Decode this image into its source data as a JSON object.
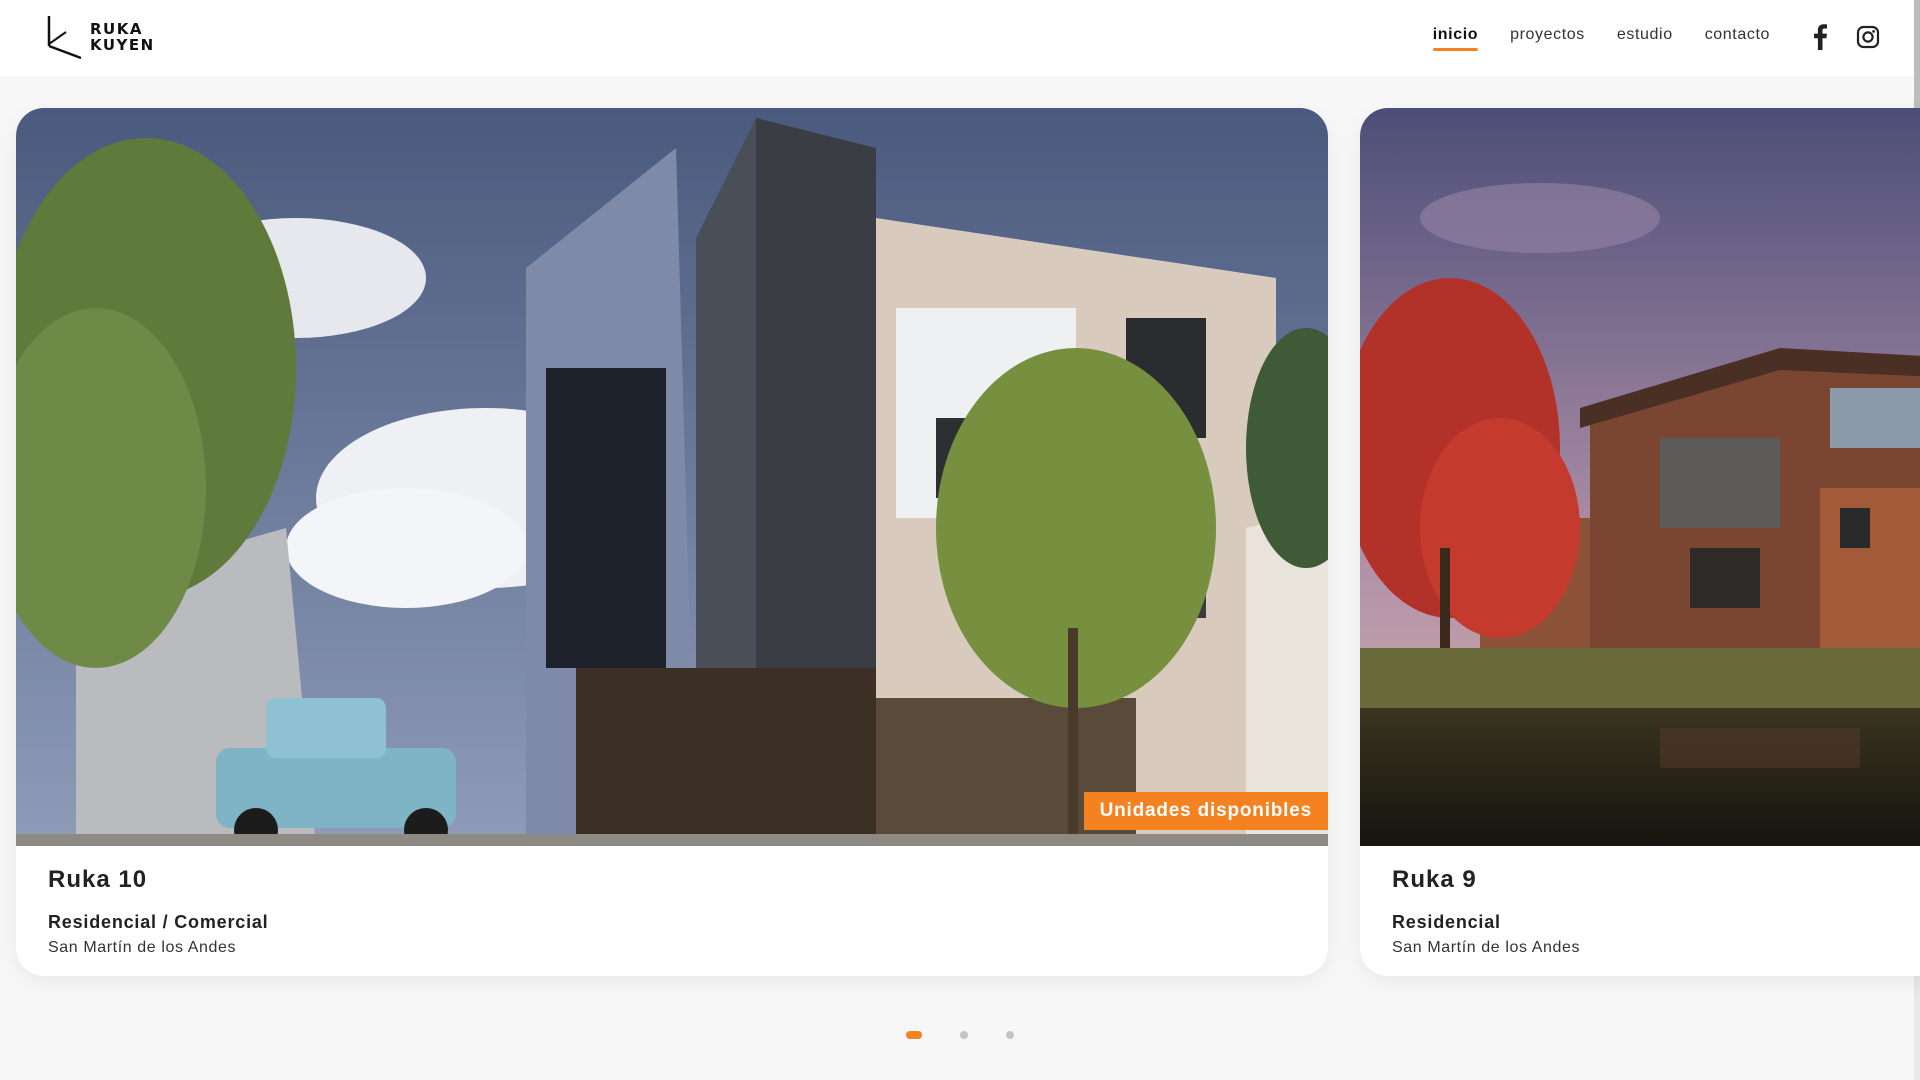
{
  "brand": {
    "line1": "RUKA",
    "line2": "KUYEN",
    "logo_icon": "k-logo-icon"
  },
  "nav": {
    "items": [
      {
        "label": "inicio",
        "active": true
      },
      {
        "label": "proyectos",
        "active": false
      },
      {
        "label": "estudio",
        "active": false
      },
      {
        "label": "contacto",
        "active": false
      }
    ]
  },
  "social": {
    "facebook_icon": "facebook-icon",
    "instagram_icon": "instagram-icon"
  },
  "colors": {
    "accent": "#f58220",
    "background": "#f7f7f7",
    "card": "#ffffff"
  },
  "projects": [
    {
      "title": "Ruka 10",
      "type": "Residencial / Comercial",
      "location": "San Martín de los Andes",
      "badge": "Unidades disponibles"
    },
    {
      "title": "Ruka 9",
      "type": "Residencial",
      "location": "San Martín de los Andes"
    }
  ],
  "pagination": {
    "pages": 3,
    "current": 1
  }
}
